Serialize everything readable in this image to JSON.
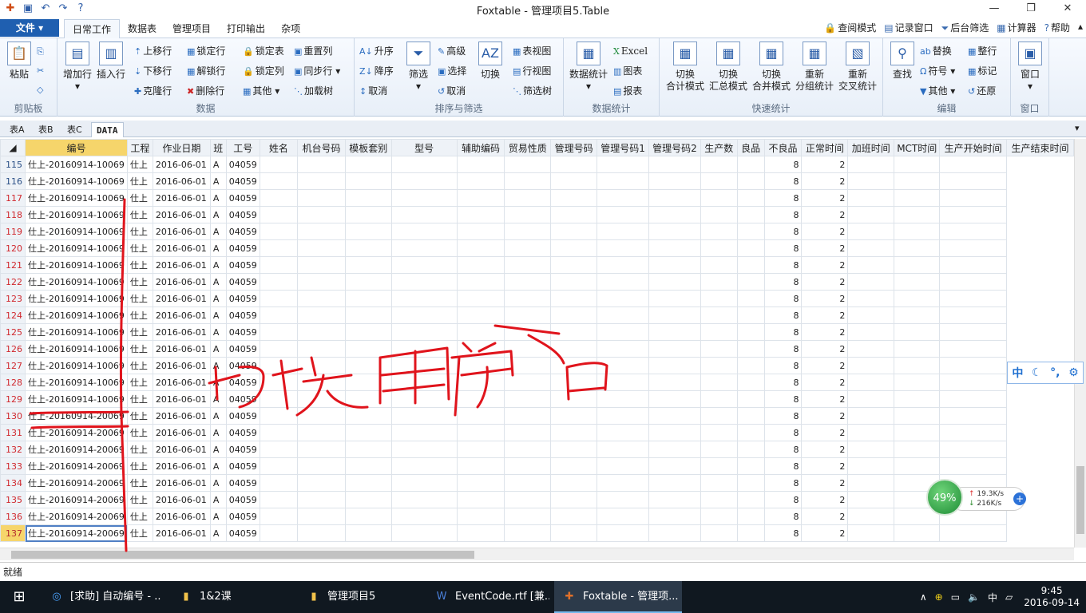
{
  "title_bar": {
    "title": "Foxtable - 管理项目5.Table"
  },
  "ribbon_tabs": {
    "file": "文件",
    "tabs": [
      "日常工作",
      "数据表",
      "管理项目",
      "打印输出",
      "杂项"
    ],
    "active": "日常工作",
    "right": [
      "查阅模式",
      "记录窗口",
      "后台筛选",
      "计算器",
      "帮助"
    ]
  },
  "ribbon": {
    "clipboard": {
      "label": "剪贴板",
      "paste": "粘贴"
    },
    "data": {
      "label": "数据",
      "add_row": "增加行",
      "insert_row": "插入行",
      "move_up": "上移行",
      "move_down": "下移行",
      "clone_row": "克隆行",
      "lock_row": "锁定行",
      "unlock_row": "解锁行",
      "delete_row": "删除行",
      "lock_table": "锁定表",
      "lock_col": "锁定列",
      "other": "其他",
      "reset_col": "重置列",
      "sync_row": "同步行",
      "load_tree": "加载树"
    },
    "sort_filter": {
      "label": "排序与筛选",
      "asc": "升序",
      "desc": "降序",
      "cancel": "取消",
      "filter": "筛选",
      "advanced": "高级",
      "select": "选择",
      "cancel2": "取消",
      "switch": "切换",
      "table_view": "表视图",
      "row_view": "行视图",
      "filter_tree": "筛选树"
    },
    "stats": {
      "label": "数据统计",
      "data_stats": "数据统计",
      "excel": "Excel",
      "chart": "图表",
      "report": "报表"
    },
    "quick_stats": {
      "label": "快速统计",
      "items": [
        {
          "line1": "切换",
          "line2": "合计模式"
        },
        {
          "line1": "切换",
          "line2": "汇总模式"
        },
        {
          "line1": "切换",
          "line2": "合并模式"
        },
        {
          "line1": "重新",
          "line2": "分组统计"
        },
        {
          "line1": "重新",
          "line2": "交叉统计"
        }
      ]
    },
    "edit": {
      "label": "编辑",
      "find": "查找",
      "replace": "替换",
      "symbol": "符号",
      "other": "其他",
      "tidy_row": "整行",
      "mark": "标记",
      "restore": "还原"
    },
    "window": {
      "label": "窗口",
      "window": "窗口"
    }
  },
  "sheet_tabs": [
    "表A",
    "表B",
    "表C",
    "DATA"
  ],
  "active_sheet": "DATA",
  "columns": [
    "编号",
    "工程",
    "作业日期",
    "班",
    "工号",
    "姓名",
    "机台号码",
    "模板套别",
    "型号",
    "辅助编码",
    "贸易性质",
    "管理号码",
    "管理号码1",
    "管理号码2",
    "生产数",
    "良品",
    "不良品",
    "正常时间",
    "加班时间",
    "MCT时间",
    "生产开始时间",
    "生产结束时间"
  ],
  "rows": [
    {
      "n": "115",
      "id": "仕上-20160914-10069",
      "proj": "仕上",
      "date": "2016-06-01",
      "cls": "A",
      "emp": "04059",
      "normal": "8",
      "ot": "2"
    },
    {
      "n": "116",
      "id": "仕上-20160914-10069",
      "proj": "仕上",
      "date": "2016-06-01",
      "cls": "A",
      "emp": "04059",
      "normal": "8",
      "ot": "2"
    },
    {
      "n": "117",
      "id": "仕上-20160914-10069",
      "proj": "仕上",
      "date": "2016-06-01",
      "cls": "A",
      "emp": "04059",
      "normal": "8",
      "ot": "2"
    },
    {
      "n": "118",
      "id": "仕上-20160914-10069",
      "proj": "仕上",
      "date": "2016-06-01",
      "cls": "A",
      "emp": "04059",
      "normal": "8",
      "ot": "2"
    },
    {
      "n": "119",
      "id": "仕上-20160914-10069",
      "proj": "仕上",
      "date": "2016-06-01",
      "cls": "A",
      "emp": "04059",
      "normal": "8",
      "ot": "2"
    },
    {
      "n": "120",
      "id": "仕上-20160914-10069",
      "proj": "仕上",
      "date": "2016-06-01",
      "cls": "A",
      "emp": "04059",
      "normal": "8",
      "ot": "2"
    },
    {
      "n": "121",
      "id": "仕上-20160914-10069",
      "proj": "仕上",
      "date": "2016-06-01",
      "cls": "A",
      "emp": "04059",
      "normal": "8",
      "ot": "2"
    },
    {
      "n": "122",
      "id": "仕上-20160914-10069",
      "proj": "仕上",
      "date": "2016-06-01",
      "cls": "A",
      "emp": "04059",
      "normal": "8",
      "ot": "2"
    },
    {
      "n": "123",
      "id": "仕上-20160914-10069",
      "proj": "仕上",
      "date": "2016-06-01",
      "cls": "A",
      "emp": "04059",
      "normal": "8",
      "ot": "2"
    },
    {
      "n": "124",
      "id": "仕上-20160914-10069",
      "proj": "仕上",
      "date": "2016-06-01",
      "cls": "A",
      "emp": "04059",
      "normal": "8",
      "ot": "2"
    },
    {
      "n": "125",
      "id": "仕上-20160914-10069",
      "proj": "仕上",
      "date": "2016-06-01",
      "cls": "A",
      "emp": "04059",
      "normal": "8",
      "ot": "2"
    },
    {
      "n": "126",
      "id": "仕上-20160914-10069",
      "proj": "仕上",
      "date": "2016-06-01",
      "cls": "A",
      "emp": "04059",
      "normal": "8",
      "ot": "2"
    },
    {
      "n": "127",
      "id": "仕上-20160914-10069",
      "proj": "仕上",
      "date": "2016-06-01",
      "cls": "A",
      "emp": "04059",
      "normal": "8",
      "ot": "2"
    },
    {
      "n": "128",
      "id": "仕上-20160914-10069",
      "proj": "仕上",
      "date": "2016-06-01",
      "cls": "A",
      "emp": "04059",
      "normal": "8",
      "ot": "2"
    },
    {
      "n": "129",
      "id": "仕上-20160914-10069",
      "proj": "仕上",
      "date": "2016-06-01",
      "cls": "A",
      "emp": "04059",
      "normal": "8",
      "ot": "2"
    },
    {
      "n": "130",
      "id": "仕上-20160914-20069",
      "proj": "仕上",
      "date": "2016-06-01",
      "cls": "A",
      "emp": "04059",
      "normal": "8",
      "ot": "2"
    },
    {
      "n": "131",
      "id": "仕上-20160914-20069",
      "proj": "仕上",
      "date": "2016-06-01",
      "cls": "A",
      "emp": "04059",
      "normal": "8",
      "ot": "2"
    },
    {
      "n": "132",
      "id": "仕上-20160914-20069",
      "proj": "仕上",
      "date": "2016-06-01",
      "cls": "A",
      "emp": "04059",
      "normal": "8",
      "ot": "2"
    },
    {
      "n": "133",
      "id": "仕上-20160914-20069",
      "proj": "仕上",
      "date": "2016-06-01",
      "cls": "A",
      "emp": "04059",
      "normal": "8",
      "ot": "2"
    },
    {
      "n": "134",
      "id": "仕上-20160914-20069",
      "proj": "仕上",
      "date": "2016-06-01",
      "cls": "A",
      "emp": "04059",
      "normal": "8",
      "ot": "2"
    },
    {
      "n": "135",
      "id": "仕上-20160914-20069",
      "proj": "仕上",
      "date": "2016-06-01",
      "cls": "A",
      "emp": "04059",
      "normal": "8",
      "ot": "2"
    },
    {
      "n": "136",
      "id": "仕上-20160914-20069",
      "proj": "仕上",
      "date": "2016-06-01",
      "cls": "A",
      "emp": "04059",
      "normal": "8",
      "ot": "2"
    },
    {
      "n": "137",
      "id": "仕上-20160914-20069",
      "proj": "仕上",
      "date": "2016-06-01",
      "cls": "A",
      "emp": "04059",
      "normal": "8",
      "ot": "2"
    }
  ],
  "current_row": "137",
  "status": "就绪",
  "ime": {
    "mode": "中",
    "punct": "°,"
  },
  "network": {
    "percent": "49%",
    "up": "19.3K/s",
    "down": "216K/s"
  },
  "taskbar": {
    "items": [
      "[求助] 自动编号 - ...",
      "1&2课",
      "管理项目5",
      "EventCode.rtf [兼...",
      "Foxtable - 管理项..."
    ],
    "active_index": 4,
    "tray_lang": "中",
    "time": "9:45",
    "date": "2016-09-14"
  },
  "annotation": {
    "handwritten_text": "切换用户后"
  }
}
